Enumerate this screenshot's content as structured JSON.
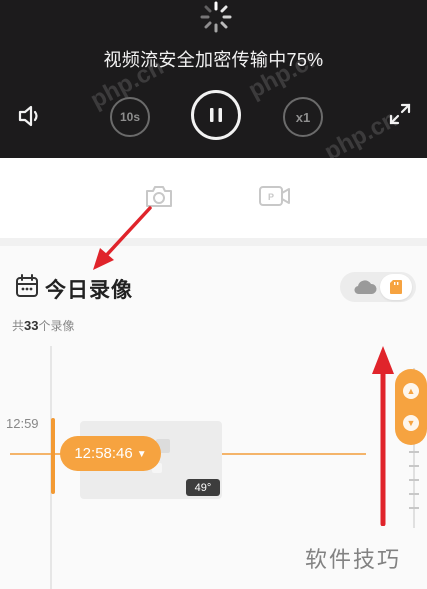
{
  "player": {
    "stream_status": "视频流安全加密传输中75%",
    "rewind_label": "10s",
    "speed_label": "x1",
    "watermark": "php.cn"
  },
  "recordings": {
    "title": "今日录像",
    "count_prefix": "共",
    "count_value": "33",
    "count_suffix": "个录像",
    "timeline_tick": "12:59",
    "current_time": "12:58:46",
    "clip_badge": "49°"
  },
  "site_watermark": "软件技巧",
  "colors": {
    "player_bg": "#1c1b1c",
    "accent": "#f6a340",
    "annotation_red": "#e0242b"
  },
  "icons": [
    "spinner-icon",
    "volume-icon",
    "pause-icon",
    "fullscreen-icon",
    "camera-icon",
    "record-icon",
    "calendar-icon",
    "cloud-icon",
    "sd-card-icon"
  ]
}
